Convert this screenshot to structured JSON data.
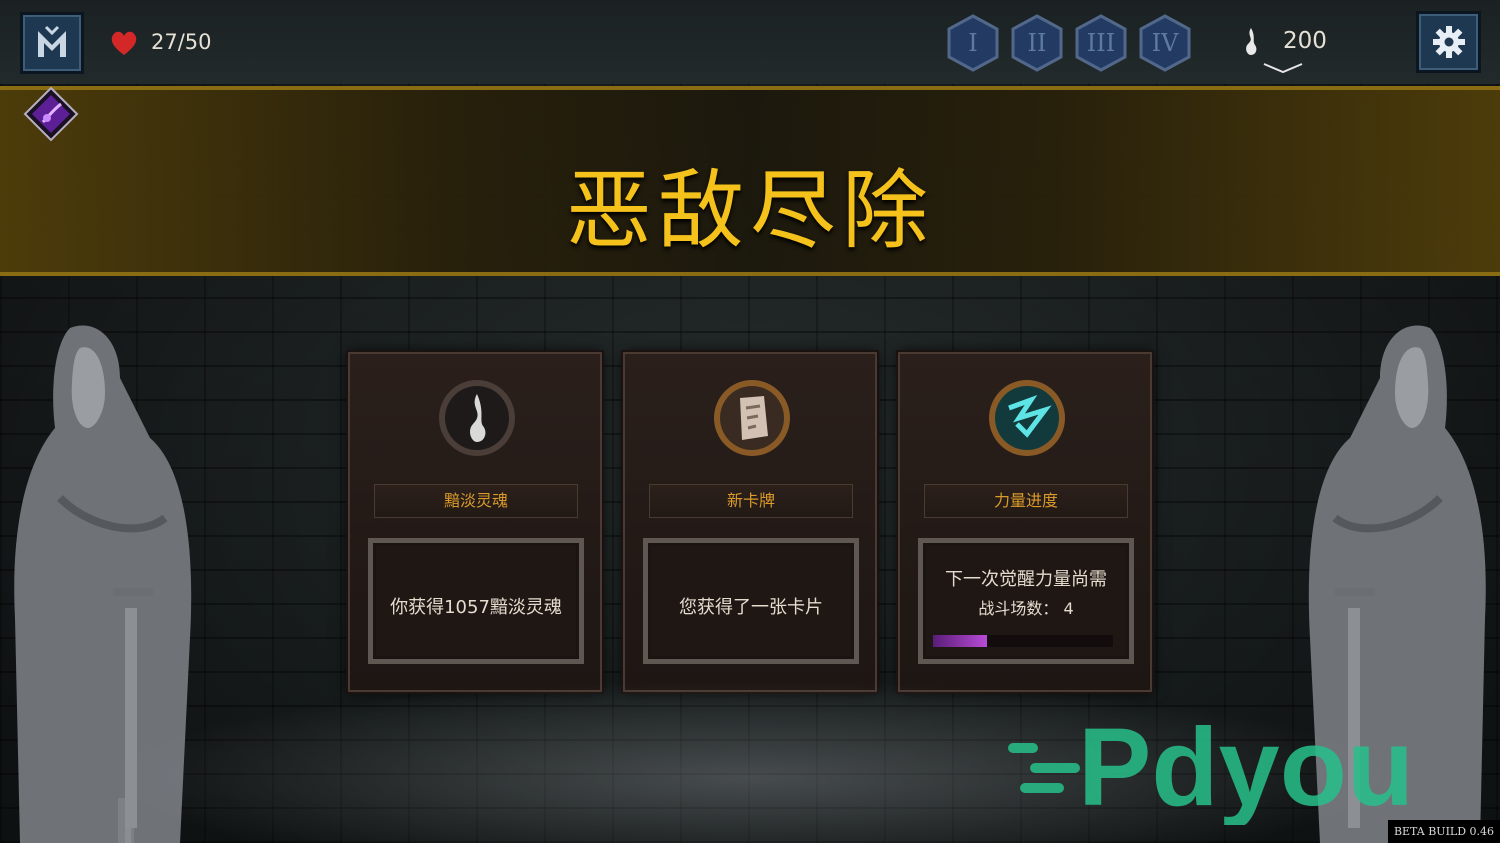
{
  "hud": {
    "health": "27/50",
    "act_buttons": [
      "I",
      "II",
      "III",
      "IV"
    ],
    "soul_count": "200",
    "icons": {
      "menu": "emblem-icon",
      "health": "heart-icon",
      "souls": "soul-flame-icon",
      "settings": "gear-icon",
      "relic": "purple-relic-icon"
    }
  },
  "banner": {
    "title": "恶敌尽除"
  },
  "rewards": [
    {
      "label": "黯淡灵魂",
      "text": "你获得1057黯淡灵魂",
      "icon": "soul-flame-icon"
    },
    {
      "label": "新卡牌",
      "text": "您获得了一张卡片",
      "icon": "card-icon"
    },
    {
      "label": "力量进度",
      "text_line1": "下一次觉醒力量尚需",
      "text_line2": "战斗场数：  4",
      "progress": 0.3,
      "icon": "power-rune-icon"
    }
  ],
  "watermark": "Pdyou",
  "build": "BETA BUILD 0.46",
  "colors": {
    "gold": "#f5c21b",
    "label": "#d99a2b",
    "panel_blue": "#1d3850"
  }
}
